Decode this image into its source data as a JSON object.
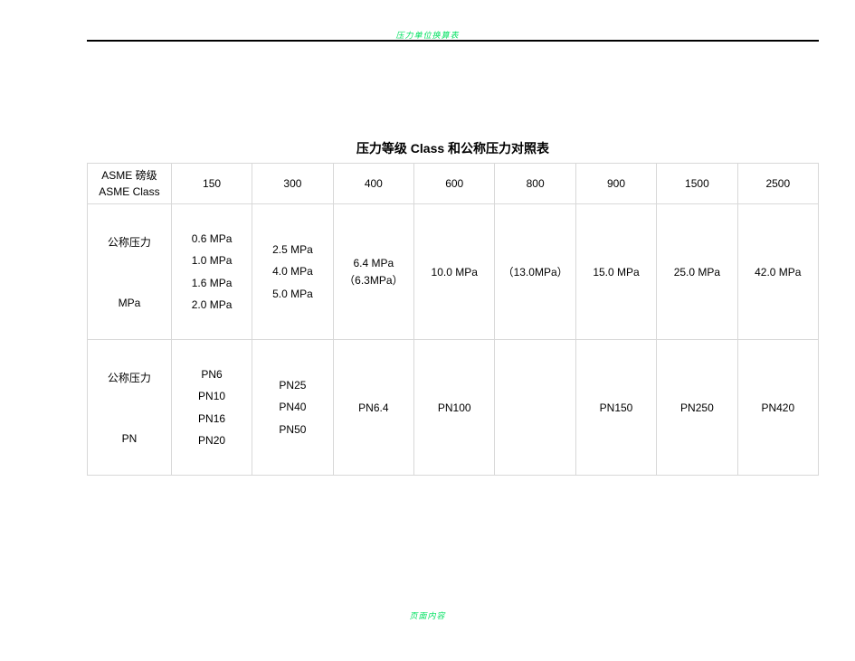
{
  "header_text": "压力单位换算表",
  "footer_text": "页面内容",
  "title": "压力等级 Class 和公称压力对照表",
  "row0": {
    "label_line1": "ASME 磅级",
    "label_line2": "ASME Class",
    "c150": "150",
    "c300": "300",
    "c400": "400",
    "c600": "600",
    "c800": "800",
    "c900": "900",
    "c1500": "1500",
    "c2500": "2500"
  },
  "row1": {
    "label_line1": "公称压力",
    "label_line2": "MPa",
    "c150": {
      "l1": "0.6 MPa",
      "l2": "1.0 MPa",
      "l3": "1.6 MPa",
      "l4": "2.0 MPa"
    },
    "c300": {
      "l1": "2.5 MPa",
      "l2": "4.0 MPa",
      "l3": "5.0 MPa"
    },
    "c400": {
      "l1": "6.4 MPa",
      "l2": "（6.3MPa）"
    },
    "c600": "10.0 MPa",
    "c800": "（13.0MPa）",
    "c900": "15.0 MPa",
    "c1500": "25.0 MPa",
    "c2500": "42.0 MPa"
  },
  "row2": {
    "label_line1": "公称压力",
    "label_line2": "PN",
    "c150": {
      "l1": "PN6",
      "l2": "PN10",
      "l3": "PN16",
      "l4": "PN20"
    },
    "c300": {
      "l1": "PN25",
      "l2": "PN40",
      "l3": "PN50"
    },
    "c400": "PN6.4",
    "c600": "PN100",
    "c800": "",
    "c900": "PN150",
    "c1500": "PN250",
    "c2500": "PN420"
  },
  "chart_data": {
    "type": "table",
    "title": "压力等级 Class 和公称压力对照表",
    "columns": [
      "ASME Class",
      "公称压力 MPa",
      "公称压力 PN"
    ],
    "rows": [
      {
        "asme_class": 150,
        "mpa": [
          "0.6 MPa",
          "1.0 MPa",
          "1.6 MPa",
          "2.0 MPa"
        ],
        "pn": [
          "PN6",
          "PN10",
          "PN16",
          "PN20"
        ]
      },
      {
        "asme_class": 300,
        "mpa": [
          "2.5 MPa",
          "4.0 MPa",
          "5.0 MPa"
        ],
        "pn": [
          "PN25",
          "PN40",
          "PN50"
        ]
      },
      {
        "asme_class": 400,
        "mpa": [
          "6.4 MPa",
          "（6.3MPa）"
        ],
        "pn": [
          "PN6.4"
        ]
      },
      {
        "asme_class": 600,
        "mpa": [
          "10.0 MPa"
        ],
        "pn": [
          "PN100"
        ]
      },
      {
        "asme_class": 800,
        "mpa": [
          "（13.0MPa）"
        ],
        "pn": []
      },
      {
        "asme_class": 900,
        "mpa": [
          "15.0 MPa"
        ],
        "pn": [
          "PN150"
        ]
      },
      {
        "asme_class": 1500,
        "mpa": [
          "25.0 MPa"
        ],
        "pn": [
          "PN250"
        ]
      },
      {
        "asme_class": 2500,
        "mpa": [
          "42.0 MPa"
        ],
        "pn": [
          "PN420"
        ]
      }
    ]
  }
}
